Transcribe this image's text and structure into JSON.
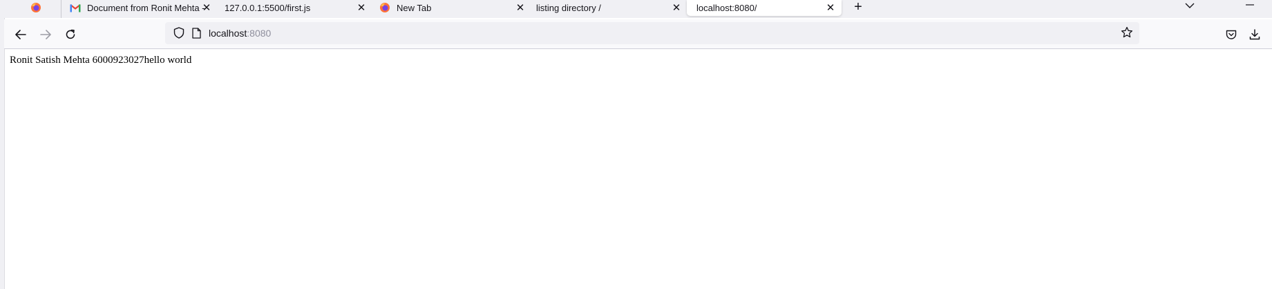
{
  "tabs": [
    {
      "title": "",
      "icon": "firefox-icon",
      "close": ""
    },
    {
      "title": "Document from Ronit Mehta -",
      "icon": "gmail-icon",
      "close": "✕"
    },
    {
      "title": "127.0.0.1:5500/first.js",
      "icon": "",
      "close": "✕"
    },
    {
      "title": "New Tab",
      "icon": "firefox-icon",
      "close": "✕"
    },
    {
      "title": "listing directory /",
      "icon": "",
      "close": "✕"
    },
    {
      "title": "localhost:8080/",
      "icon": "",
      "close": "✕",
      "active": true
    }
  ],
  "new_tab_label": "+",
  "address": {
    "host": "localhost",
    "port": ":8080"
  },
  "page": {
    "body_text": "Ronit Satish Mehta 6000923027hello world"
  },
  "colors": {
    "tabbar_bg": "#f0f0f4",
    "navbar_bg": "#f9f9fb",
    "urlbar_bg": "#f0f0f4",
    "firefox_orange": "#ff7139",
    "gmail_red": "#ea4335"
  }
}
